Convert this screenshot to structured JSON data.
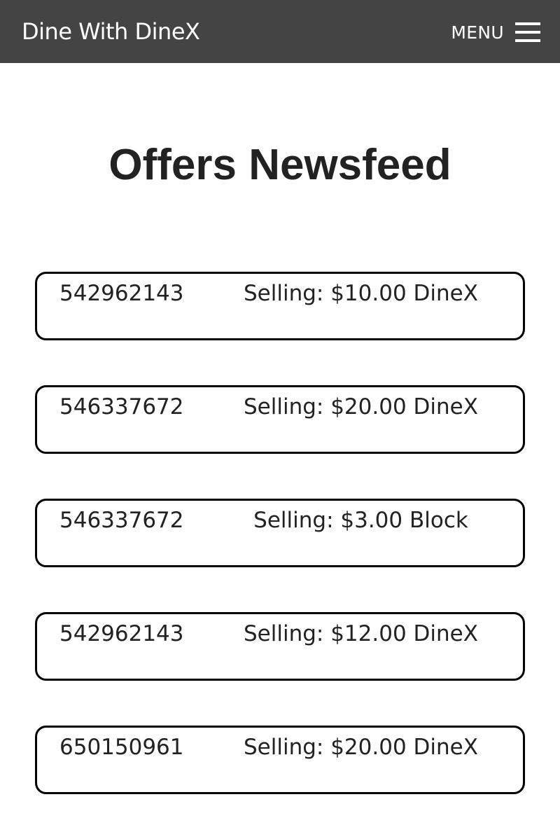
{
  "navbar": {
    "brand": "Dine With DineX",
    "menu_label": "MENU",
    "menu_icon": "hamburger-icon",
    "background": "#444444"
  },
  "page": {
    "title": "Offers Newsfeed"
  },
  "offers": [
    {
      "id": "542962143",
      "description": "Selling: $10.00 DineX"
    },
    {
      "id": "546337672",
      "description": "Selling: $20.00 DineX"
    },
    {
      "id": "546337672",
      "description": "Selling: $3.00 Block"
    },
    {
      "id": "542962143",
      "description": "Selling: $12.00 DineX"
    },
    {
      "id": "650150961",
      "description": "Selling: $20.00 DineX"
    }
  ]
}
